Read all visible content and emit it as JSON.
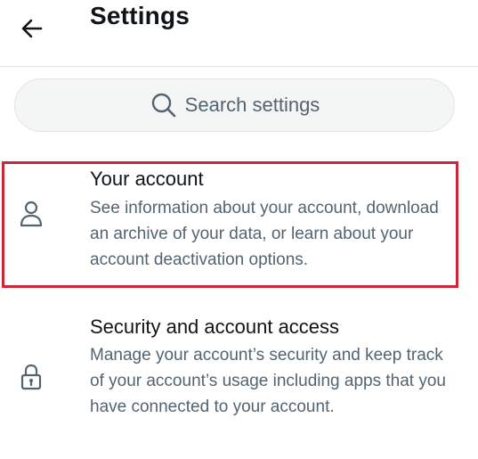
{
  "header": {
    "title": "Settings",
    "back_icon": "arrow-left-icon"
  },
  "search": {
    "placeholder": "Search settings",
    "icon": "search-icon"
  },
  "items": [
    {
      "title": "Your account",
      "description": "See information about your account, download an archive of your data, or learn about your account deactivation options.",
      "icon": "person-icon",
      "highlighted": true
    },
    {
      "title": "Security and account access",
      "description": "Manage your account’s security and keep track of your account’s usage including apps that you have connected to your account.",
      "icon": "lock-icon",
      "highlighted": false
    }
  ],
  "colors": {
    "highlight": "#c8283a",
    "secondary_text": "#536471",
    "primary_text": "#0f1419"
  }
}
